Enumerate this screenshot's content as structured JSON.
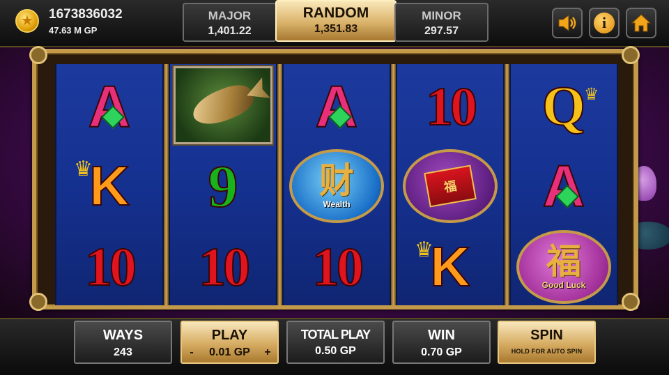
{
  "account": {
    "id": "1673836032",
    "balance": "47.63 M GP"
  },
  "jackpots": {
    "major": {
      "label": "MAJOR",
      "value": "1,401.22"
    },
    "random": {
      "label": "RANDOM",
      "value": "1,351.83"
    },
    "minor": {
      "label": "MINOR",
      "value": "297.57"
    }
  },
  "controls": {
    "icons": [
      "speaker-icon",
      "info-icon",
      "home-icon"
    ],
    "info_glyph": "i"
  },
  "reels": [
    [
      "A",
      "K",
      "10"
    ],
    [
      "koi",
      "9",
      "10"
    ],
    [
      "A",
      "wealth",
      "10"
    ],
    [
      "10",
      "red-envelope",
      "K"
    ],
    [
      "Q",
      "A",
      "good-luck"
    ]
  ],
  "symbols": {
    "A": "A",
    "K": "K",
    "Q": "Q",
    "ten": "10",
    "nine": "9",
    "wealth_char": "财",
    "wealth_word": "Wealth",
    "envelope_char": "福",
    "luck_char": "福",
    "luck_word": "Good Luck"
  },
  "bottom": {
    "ways": {
      "label": "WAYS",
      "value": "243"
    },
    "play": {
      "label": "PLAY",
      "value": "0.01 GP",
      "minus": "-",
      "plus": "+"
    },
    "total_play": {
      "label": "TOTAL PLAY",
      "value": "0.50 GP"
    },
    "win": {
      "label": "WIN",
      "value": "0.70 GP"
    },
    "spin": {
      "label": "SPIN",
      "sub": "HOLD FOR AUTO SPIN"
    }
  },
  "colors": {
    "accent_gold": "#d6ac62",
    "reel_blue": "#153190",
    "background_purple": "#6e1a86"
  }
}
